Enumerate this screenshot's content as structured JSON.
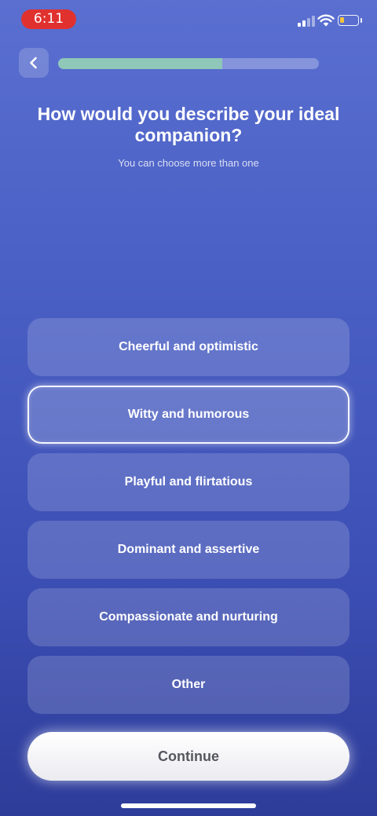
{
  "status_bar": {
    "time": "6:11",
    "time_pill_color": "#e0312f",
    "battery_level": 0.25,
    "battery_color": "#f2c53d",
    "icons": [
      "cellular-signal-icon",
      "wifi-icon",
      "battery-icon"
    ]
  },
  "header": {
    "back_icon": "chevron-left-icon",
    "progress": 0.63,
    "progress_color": "#8fc7b8"
  },
  "question": {
    "title": "How would you describe your ideal companion?",
    "subtitle": "You can choose more than one"
  },
  "options": [
    {
      "label": "Cheerful and optimistic",
      "selected": false
    },
    {
      "label": "Witty and humorous",
      "selected": true
    },
    {
      "label": "Playful and flirtatious",
      "selected": false
    },
    {
      "label": "Dominant and assertive",
      "selected": false
    },
    {
      "label": "Compassionate and nurturing",
      "selected": false
    },
    {
      "label": "Other",
      "selected": false
    }
  ],
  "footer": {
    "continue_label": "Continue"
  }
}
